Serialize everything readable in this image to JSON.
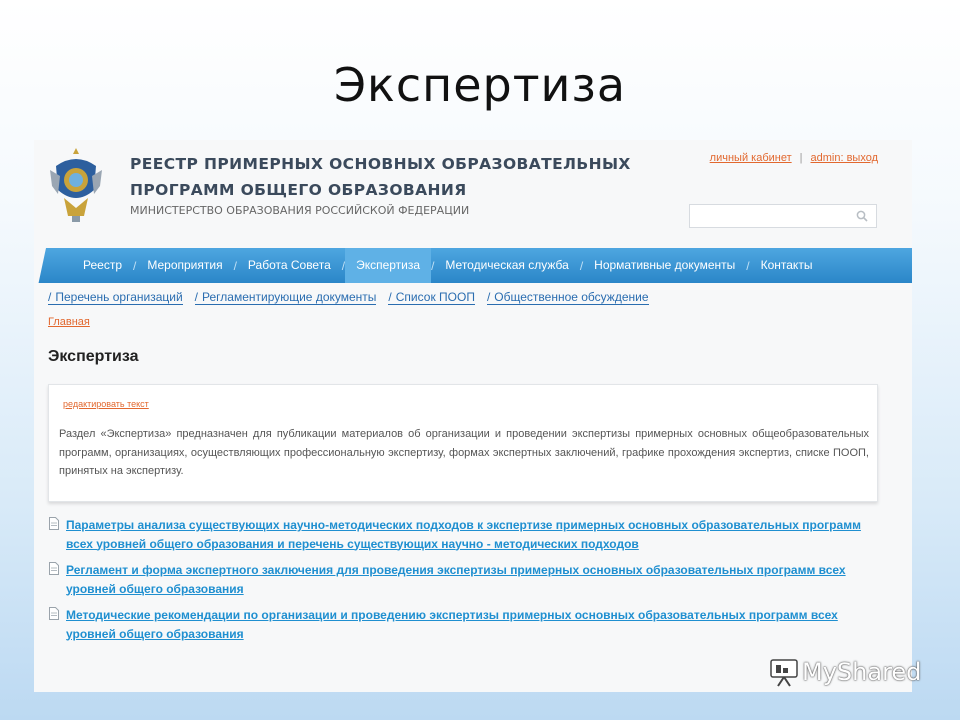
{
  "slide": {
    "title": "Экспертиза"
  },
  "header": {
    "title_line1": "РЕЕСТР ПРИМЕРНЫХ ОСНОВНЫХ ОБРАЗОВАТЕЛЬНЫХ",
    "title_line2": "ПРОГРАММ ОБЩЕГО ОБРАЗОВАНИЯ",
    "ministry": "МИНИСТЕРСТВО ОБРАЗОВАНИЯ РОССИЙСКОЙ ФЕДЕРАЦИИ",
    "account_link": "личный кабинет",
    "separator": "|",
    "logout_link": "admin: выход",
    "search_placeholder": ""
  },
  "nav": {
    "items": [
      {
        "label": "Реестр"
      },
      {
        "label": "Мероприятия"
      },
      {
        "label": "Работа Совета"
      },
      {
        "label": "Экспертиза",
        "active": true
      },
      {
        "label": "Методическая служба"
      },
      {
        "label": "Нормативные документы"
      },
      {
        "label": "Контакты"
      }
    ],
    "separator": "/"
  },
  "subnav": {
    "items": [
      {
        "label": "Перечень организаций"
      },
      {
        "label": "Регламентирующие документы"
      },
      {
        "label": "Список ПООП"
      },
      {
        "label": "Общественное обсуждение"
      }
    ]
  },
  "breadcrumb": {
    "home": "Главная"
  },
  "page": {
    "heading": "Экспертиза",
    "edit_link": "редактировать текст",
    "description": "Раздел «Экспертиза» предназначен для публикации материалов об организации и проведении  экспертизы примерных основных общеобразовательных программ, организациях, осуществляющих профессиональную экспертизу, формах экспертных заключений, графике прохождения экспертиз, списке ПООП, принятых на экспертизу."
  },
  "documents": [
    {
      "title": "Параметры анализа существующих научно-методических подходов к экспертизе примерных основных образовательных программ всех уровней общего образования и перечень существующих научно - методических подходов"
    },
    {
      "title": "Регламент и форма экспертного заключения для проведения экспертизы примерных основных образовательных программ всех уровней общего образования"
    },
    {
      "title": "Методические рекомендации по организации и проведению экспертизы примерных основных образовательных программ всех уровней общего образования"
    }
  ],
  "watermark": {
    "text": "MyShared"
  },
  "colors": {
    "nav_blue": "#2b86c8",
    "link_orange": "#e2682f",
    "doc_link_blue": "#1f8fd0"
  },
  "icons": {
    "search": "search-icon",
    "document": "document-icon",
    "logo": "emblem-logo"
  }
}
